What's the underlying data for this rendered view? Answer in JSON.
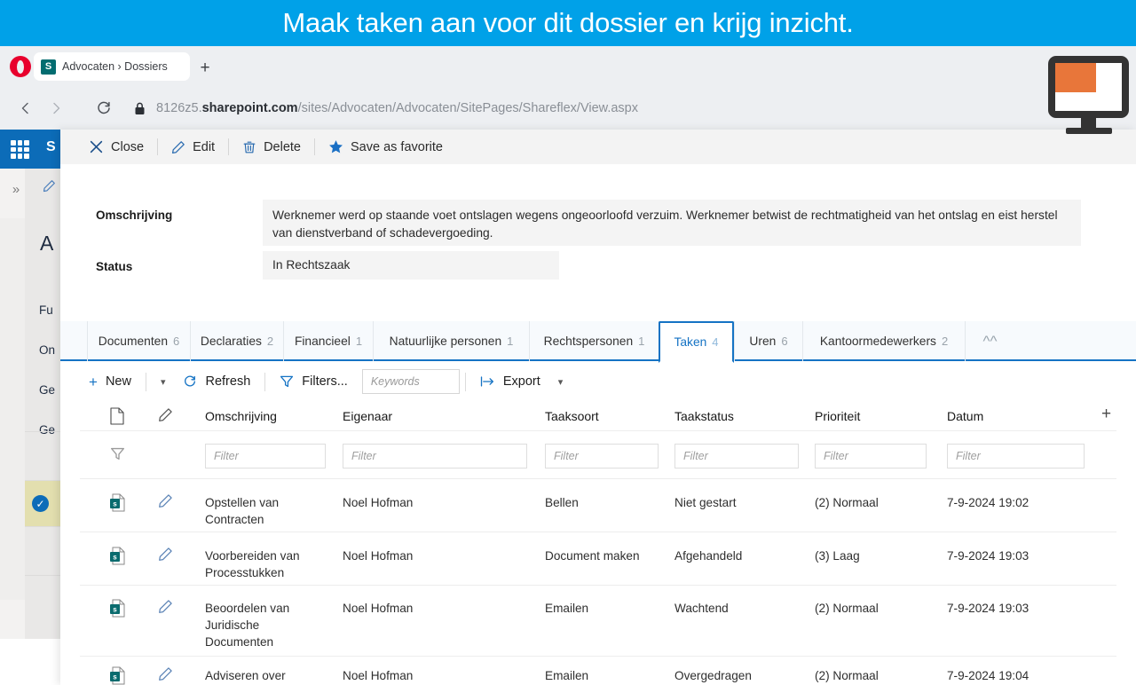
{
  "banner": {
    "text": "Maak taken aan voor dit dossier en krijg inzicht."
  },
  "browser": {
    "name": "opera-browser",
    "tab": {
      "title": "Advocaten › Dossiers",
      "favicon": "sharepoint-icon"
    },
    "newtab_label": "+",
    "nav": {
      "back": "‹",
      "forward": "›",
      "reload": "⟳",
      "lock": "lock-icon"
    },
    "url": {
      "host_prefix": "8126z5.",
      "host_bold": "sharepoint",
      "host_suffix": ".com",
      "path": "/sites/Advocaten/Advocaten/SitePages/Shareflex/View.aspx"
    }
  },
  "sharepoint_bg": {
    "suite_letter": "S",
    "big_letter": "A",
    "nav_items": [
      "Fu",
      "On",
      "Ge",
      "Ge"
    ]
  },
  "panel": {
    "toolbar": [
      {
        "label": "Close",
        "icon": "close-icon"
      },
      {
        "label": "Edit",
        "icon": "pencil-icon"
      },
      {
        "label": "Delete",
        "icon": "trash-icon"
      },
      {
        "label": "Save as favorite",
        "icon": "star-icon"
      }
    ],
    "form": [
      {
        "label": "Omschrijving",
        "value": "Werknemer werd op staande voet ontslagen wegens ongeoorloofd verzuim. Werknemer betwist de rechtmatigheid van het ontslag en eist herstel van dienstverband of schadevergoeding."
      },
      {
        "label": "Status",
        "value": "In Rechtszaak"
      }
    ],
    "tabs": [
      {
        "label": "Documenten",
        "count": "6",
        "active": false
      },
      {
        "label": "Declaraties",
        "count": "2",
        "active": false
      },
      {
        "label": "Financieel",
        "count": "1",
        "active": false
      },
      {
        "label": "Natuurlijke personen",
        "count": "1",
        "active": false
      },
      {
        "label": "Rechtspersonen",
        "count": "1",
        "active": false
      },
      {
        "label": "Taken",
        "count": "4",
        "active": true
      },
      {
        "label": "Uren",
        "count": "6",
        "active": false
      },
      {
        "label": "Kantoormedewerkers",
        "count": "2",
        "active": false
      }
    ],
    "collapse_icon": "chevron-up-icon",
    "commandbar": {
      "new_label": "New",
      "new_icon": "plus-icon",
      "new_chevron": "chevron-down-icon",
      "refresh_label": "Refresh",
      "refresh_icon": "refresh-icon",
      "filters_label": "Filters...",
      "filters_icon": "funnel-icon",
      "keywords_placeholder": "Keywords",
      "keywords_value": "",
      "export_label": "Export",
      "export_icon": "export-icon",
      "export_chevron": "chevron-down-icon"
    },
    "table": {
      "columns": [
        "Omschrijving",
        "Eigenaar",
        "Taaksoort",
        "Taakstatus",
        "Prioriteit",
        "Datum"
      ],
      "doc_column_icon": "document-icon",
      "edit_column_icon": "pencil-icon",
      "add_column_icon": "plus-icon",
      "filter_row_icon": "funnel-icon",
      "filter_placeholder": "Filter",
      "rows": [
        {
          "omschrijving": "Opstellen van Contracten",
          "eigenaar": "Noel Hofman",
          "taaksoort": "Bellen",
          "taakstatus": "Niet gestart",
          "prioriteit": "(2) Normaal",
          "datum": "7-9-2024 19:02"
        },
        {
          "omschrijving": "Voorbereiden van Processtukken",
          "eigenaar": "Noel Hofman",
          "taaksoort": "Document maken",
          "taakstatus": "Afgehandeld",
          "prioriteit": "(3) Laag",
          "datum": "7-9-2024 19:03"
        },
        {
          "omschrijving": "Beoordelen van Juridische Documenten",
          "eigenaar": "Noel Hofman",
          "taaksoort": "Emailen",
          "taakstatus": "Wachtend",
          "prioriteit": "(2) Normaal",
          "datum": "7-9-2024 19:03"
        },
        {
          "omschrijving": "Adviseren over",
          "eigenaar": "Noel Hofman",
          "taaksoort": "Emailen",
          "taakstatus": "Overgedragen",
          "prioriteit": "(2) Normaal",
          "datum": "7-9-2024 19:04"
        }
      ]
    }
  },
  "watermark": {
    "icon": "monitor-icon"
  },
  "colors": {
    "banner": "#00A1E8",
    "accent": "#1573C4",
    "sharepoint_teal": "#036C70",
    "opera_red": "#E8002D",
    "monitor_orange": "#E8763A",
    "suitebar_blue": "#0C6CB8",
    "selected_row": "#E3DFAF"
  }
}
